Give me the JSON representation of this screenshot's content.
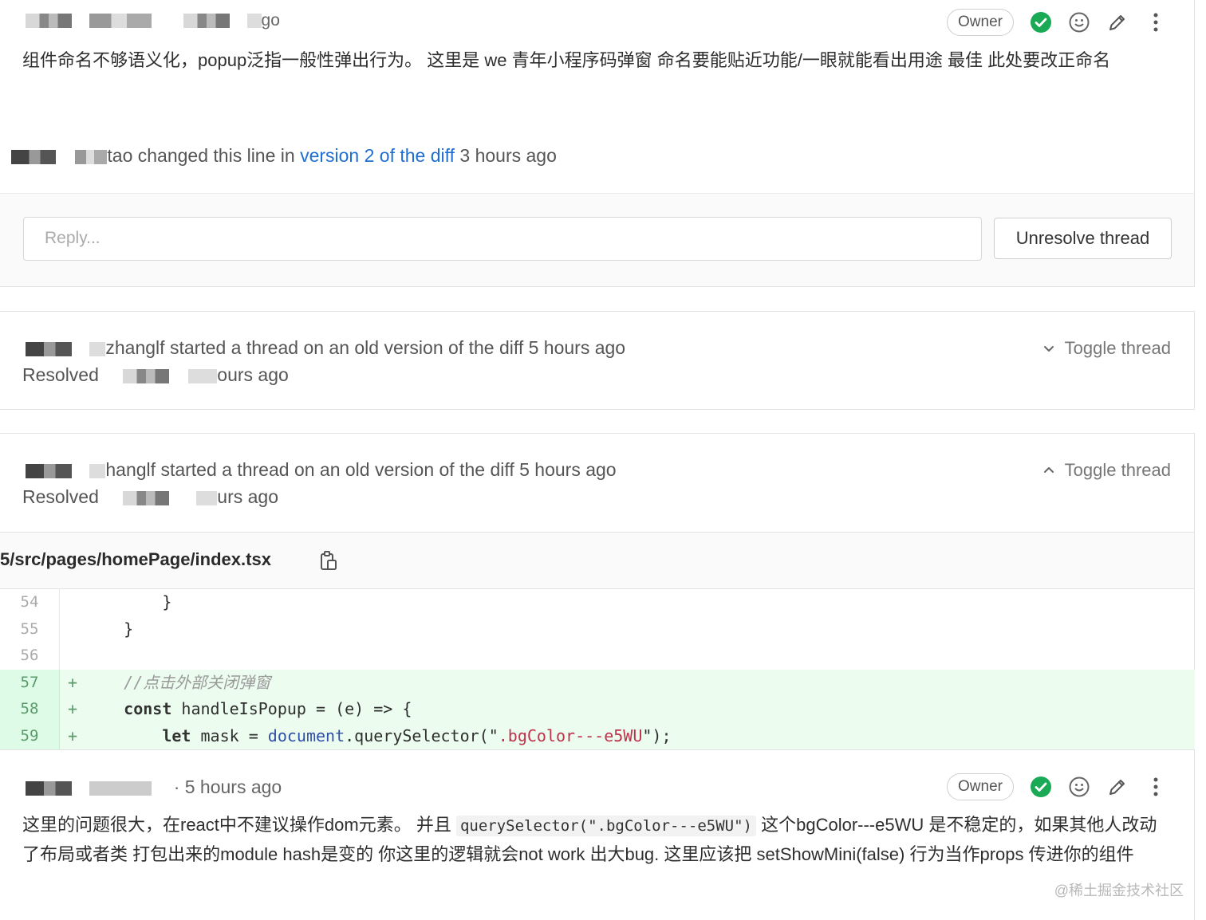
{
  "comment_top": {
    "time_fragment": "go",
    "owner_badge": "Owner",
    "body": "组件命名不够语义化，popup泛指一般性弹出行为。 这里是 we 青年小程序码弹窗 命名要能贴近功能/一眼就能看出用途 最佳 此处要改正命名"
  },
  "system_note": {
    "author_fragment": "tao",
    "text_before": " changed this line in ",
    "link": "version 2 of the diff",
    "text_after": " 3 hours ago"
  },
  "reply": {
    "placeholder": "Reply...",
    "unresolve_button": "Unresolve thread"
  },
  "threads": [
    {
      "author_fragment": "zhanglf",
      "text": " started a thread on an old version of the diff 5 hours ago",
      "resolved_prefix": "Resolved ",
      "resolved_suffix": "ours ago",
      "toggle_label": "Toggle thread",
      "toggle_state": "collapsed"
    },
    {
      "author_fragment": "hanglf",
      "text": " started a thread on an old version of the diff 5 hours ago",
      "resolved_prefix": "Resolved ",
      "resolved_suffix": "urs ago",
      "toggle_label": "Toggle thread",
      "toggle_state": "expanded"
    }
  ],
  "file": {
    "path": "5/src/pages/homePage/index.tsx"
  },
  "diff_lines": [
    {
      "num": "54",
      "sign": "",
      "code": "        }"
    },
    {
      "num": "55",
      "sign": "",
      "code": "    }"
    },
    {
      "num": "56",
      "sign": "",
      "code": ""
    },
    {
      "num": "57",
      "sign": "+",
      "code": "    //点击外部关闭弹窗"
    },
    {
      "num": "58",
      "sign": "+",
      "code": "    const handleIsPopup = (e) => {"
    },
    {
      "num": "59",
      "sign": "+",
      "code": "        let mask = document.querySelector(\".bgColor---e5WU\");"
    }
  ],
  "comment_bottom": {
    "time": "· 5 hours ago",
    "owner_badge": "Owner",
    "body_part1": "这里的问题很大，在react中不建议操作dom元素。 并且 ",
    "inline_code": "querySelector(\".bgColor---e5WU\")",
    "body_part2": " 这个bgColor---e5WU 是不稳定的，如果其他人改动了布局或者类 打包出来的module hash是变的 你这里的逻辑就会not work 出大bug. 这里应该把 setShowMini(false) 行为当作props 传进你的组件"
  },
  "watermark": "@稀土掘金技术社区",
  "colors": {
    "link": "#1f6fd1",
    "resolved_check": "#1aaa55",
    "added_bg": "#ecfdf0"
  },
  "icons": [
    "check-circle-icon",
    "smiley-icon",
    "pencil-icon",
    "more-vertical-icon",
    "chevron-down-icon",
    "chevron-up-icon",
    "clipboard-icon"
  ]
}
